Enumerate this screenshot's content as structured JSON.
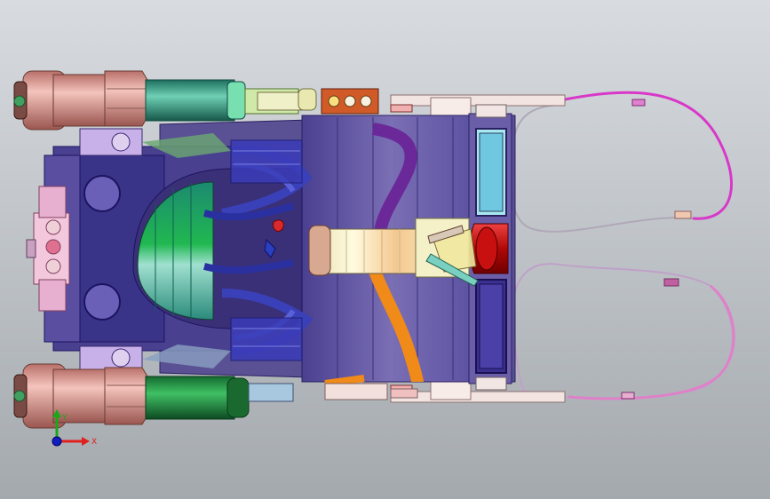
{
  "viewport": {
    "background_top": "#d8dce0",
    "background_bottom": "#a4a9ae"
  },
  "triad": {
    "x_label": "X",
    "y_label": "Y",
    "x_color": "#e0201c",
    "y_color": "#18a818",
    "z_color": "#1020c0"
  },
  "colors": {
    "salmon": "#e8a49c",
    "teal": "#3fa88e",
    "green": "#2a9a4c",
    "navy": "#2a2870",
    "purple": "#6a60a8",
    "lavender": "#b8aad8",
    "blue": "#3a40b8",
    "orange": "#f08a18",
    "magenta": "#d838c8",
    "pink": "#d87ab8",
    "pale_yellow": "#f6f0c8",
    "red": "#d81c1c",
    "cyan": "#a8e8f0",
    "rust": "#d05a28",
    "light_pink": "#f0c0d8"
  }
}
